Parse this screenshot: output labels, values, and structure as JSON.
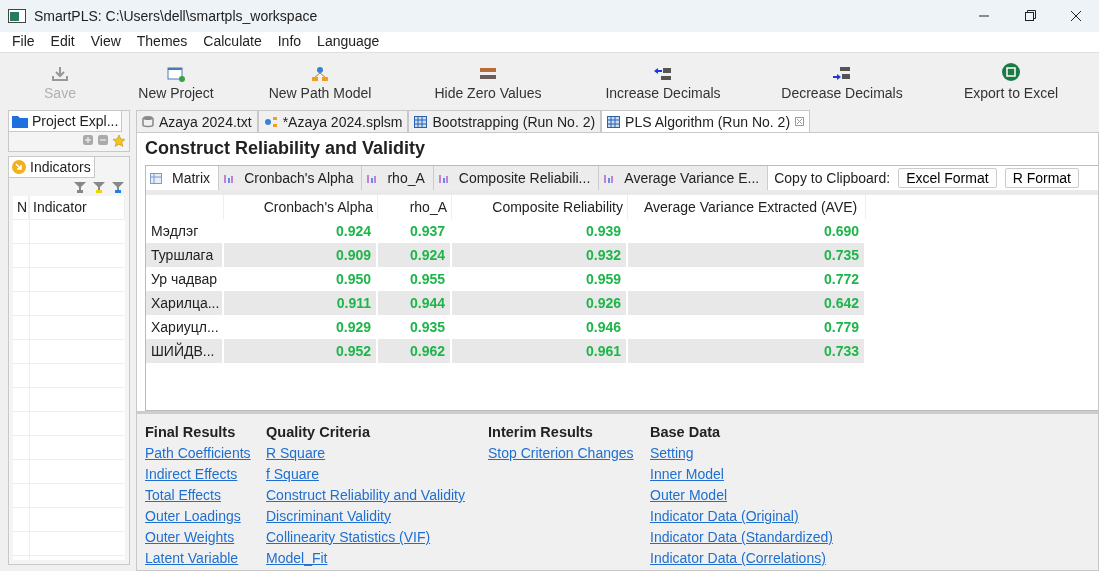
{
  "window": {
    "title": "SmartPLS: C:\\Users\\dell\\smartpls_workspace"
  },
  "menu": [
    "File",
    "Edit",
    "View",
    "Themes",
    "Calculate",
    "Info",
    "Language"
  ],
  "toolbar": [
    {
      "label": "Save",
      "kind": "save",
      "disabled": true
    },
    {
      "label": "New Project",
      "kind": "project",
      "disabled": false
    },
    {
      "label": "New Path Model",
      "kind": "model",
      "disabled": false
    },
    {
      "label": "Hide Zero Values",
      "kind": "zero",
      "disabled": false
    },
    {
      "label": "Increase Decimals",
      "kind": "increase",
      "disabled": false
    },
    {
      "label": "Decrease Decimals",
      "kind": "decrease",
      "disabled": false
    },
    {
      "label": "Export to Excel",
      "kind": "excel",
      "disabled": false
    }
  ],
  "explorer": {
    "title": "Project Expl..."
  },
  "indicators": {
    "title": "Indicators",
    "columns": [
      "N",
      "Indicator"
    ]
  },
  "editor_tabs": [
    {
      "label": "Azaya 2024.txt",
      "kind": "data",
      "selected": false
    },
    {
      "label": "*Azaya 2024.splsm",
      "kind": "model",
      "selected": false
    },
    {
      "label": "Bootstrapping (Run No. 2)",
      "kind": "report",
      "selected": false
    },
    {
      "label": "PLS Algorithm (Run No. 2)",
      "kind": "report",
      "selected": true
    }
  ],
  "report": {
    "title": "Construct Reliability and Validity",
    "view_tabs": [
      {
        "label": "Matrix",
        "kind": "matrix",
        "selected": true
      },
      {
        "label": "Cronbach's Alpha",
        "kind": "chart",
        "selected": false
      },
      {
        "label": "rho_A",
        "kind": "chart",
        "selected": false
      },
      {
        "label": "Composite Reliabili...",
        "kind": "chart",
        "selected": false
      },
      {
        "label": "Average Variance E...",
        "kind": "chart",
        "selected": false
      }
    ],
    "clipboard": {
      "label": "Copy to Clipboard:",
      "buttons": [
        "Excel Format",
        "R Format"
      ]
    },
    "table": {
      "columns": [
        "Cronbach's Alpha",
        "rho_A",
        "Composite Reliability",
        "Average Variance Extracted (AVE)"
      ],
      "rows": [
        {
          "name": "Мэдлэг",
          "values": [
            "0.924",
            "0.937",
            "0.939",
            "0.690"
          ]
        },
        {
          "name": "Туршлага",
          "values": [
            "0.909",
            "0.924",
            "0.932",
            "0.735"
          ]
        },
        {
          "name": "Ур чадвар",
          "values": [
            "0.950",
            "0.955",
            "0.959",
            "0.772"
          ]
        },
        {
          "name": "Харилца...",
          "values": [
            "0.911",
            "0.944",
            "0.926",
            "0.642"
          ]
        },
        {
          "name": "Хариуцл...",
          "values": [
            "0.929",
            "0.935",
            "0.946",
            "0.779"
          ]
        },
        {
          "name": "ШИЙДВ...",
          "values": [
            "0.952",
            "0.962",
            "0.961",
            "0.733"
          ]
        }
      ]
    }
  },
  "sections": [
    {
      "heading": "Final Results",
      "links": [
        "Path Coefficients",
        "Indirect Effects",
        "Total Effects",
        "Outer Loadings",
        "Outer Weights",
        "Latent Variable"
      ]
    },
    {
      "heading": "Quality Criteria",
      "links": [
        "R Square",
        "f Square",
        "Construct Reliability and Validity",
        "Discriminant Validity",
        "Collinearity Statistics (VIF)",
        "Model_Fit"
      ]
    },
    {
      "heading": "Interim Results",
      "links": [
        "Stop Criterion Changes"
      ]
    },
    {
      "heading": "Base Data",
      "links": [
        "Setting",
        "Inner Model",
        "Outer Model",
        "Indicator Data (Original)",
        "Indicator Data (Standardized)",
        "Indicator Data (Correlations)"
      ]
    }
  ]
}
